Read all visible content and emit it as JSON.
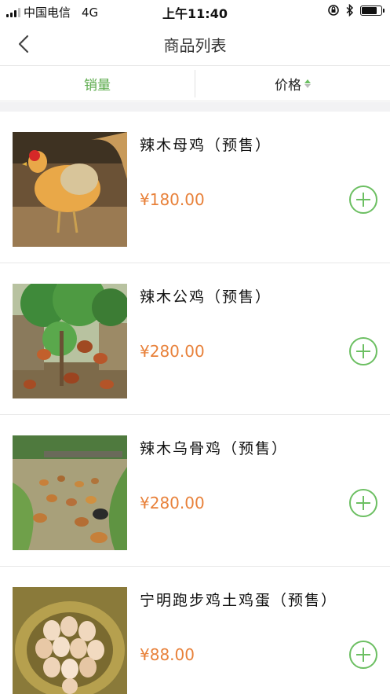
{
  "status_bar": {
    "carrier": "中国电信",
    "network": "4G",
    "time": "上午11:40"
  },
  "nav": {
    "title": "商品列表",
    "back_icon": "chevron-left-icon"
  },
  "sort_tabs": {
    "sales_label": "销量",
    "price_label": "价格",
    "active_tab": "sales",
    "accent_color": "#5aaa4a"
  },
  "products": [
    {
      "name": "辣木母鸡（预售）",
      "price": "¥180.00",
      "image": "hen"
    },
    {
      "name": "辣木公鸡（预售）",
      "price": "¥280.00",
      "image": "rooster-flock"
    },
    {
      "name": "辣木乌骨鸡（预售）",
      "price": "¥280.00",
      "image": "free-range-chickens"
    },
    {
      "name": "宁明跑步鸡土鸡蛋（预售）",
      "price": "¥88.00",
      "image": "eggs-in-nest"
    }
  ],
  "colors": {
    "price": "#e8813a",
    "add_button": "#6cbf62"
  }
}
